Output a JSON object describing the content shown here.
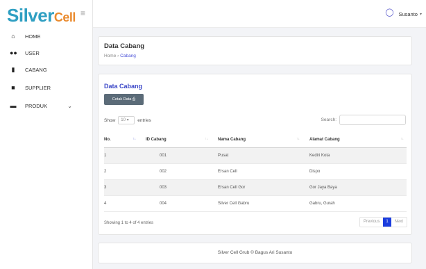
{
  "brand": {
    "part1": "Silver",
    "part2": "Cell"
  },
  "sidebar": {
    "items": [
      {
        "label": "HOME",
        "icon": "home-icon"
      },
      {
        "label": "USER",
        "icon": "users-icon"
      },
      {
        "label": "CABANG",
        "icon": "building-icon"
      },
      {
        "label": "SUPPLIER",
        "icon": "truck-icon"
      },
      {
        "label": "PRODUK",
        "icon": "box-icon"
      }
    ]
  },
  "topbar": {
    "user_name": "Susanto"
  },
  "header": {
    "title": "Data Cabang",
    "breadcrumb_home": "Home",
    "breadcrumb_sep": "›",
    "breadcrumb_current": "Cabang"
  },
  "main": {
    "title": "Data Cabang",
    "print_button": "Cetak Data ⎙",
    "show_label": "Show",
    "entries_value": "10",
    "entries_label": "entries",
    "search_label": "Search:",
    "columns": [
      "No.",
      "ID Cabang",
      "Nama Cabang",
      "Alamat Cabang"
    ],
    "rows": [
      [
        "1",
        "001",
        "Pusat",
        "Kediri Kota"
      ],
      [
        "2",
        "002",
        "Ersan Cell",
        "Dispo"
      ],
      [
        "3",
        "003",
        "Ersan Cell Gor",
        "Gor Jaya Baya"
      ],
      [
        "4",
        "004",
        "Silver Cell Gabru",
        "Gabru, Gurah"
      ]
    ],
    "info": "Showing 1 to 4 of 4 entries",
    "pager": {
      "prev": "Previous",
      "current": "1",
      "next": "Next"
    }
  },
  "footer": {
    "text": "Silver Cell Grub © Bagus Ari Susanto"
  },
  "colors": {
    "brand_blue": "#2f9fc2",
    "brand_orange": "#ea8b2f",
    "accent": "#3a46c7",
    "page_active": "#1b3dde"
  }
}
